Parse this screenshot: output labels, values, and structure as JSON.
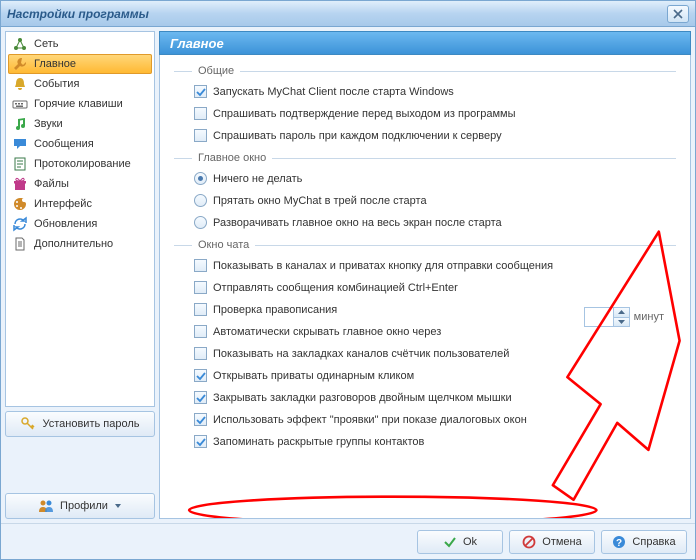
{
  "title": "Настройки программы",
  "section_title": "Главное",
  "sidebar": {
    "items": [
      {
        "key": "network",
        "label": "Сеть",
        "icon": "network-icon",
        "color": "#4a8a3a"
      },
      {
        "key": "main",
        "label": "Главное",
        "icon": "wrench-icon",
        "color": "#d08a2a",
        "selected": true
      },
      {
        "key": "events",
        "label": "События",
        "icon": "bell-icon",
        "color": "#d9a82a"
      },
      {
        "key": "hotkeys",
        "label": "Горячие клавиши",
        "icon": "keyboard-icon",
        "color": "#6a6a6a"
      },
      {
        "key": "sounds",
        "label": "Звуки",
        "icon": "music-icon",
        "color": "#3aa84a"
      },
      {
        "key": "messages",
        "label": "Сообщения",
        "icon": "chat-icon",
        "color": "#3a8ad8"
      },
      {
        "key": "logging",
        "label": "Протоколирование",
        "icon": "log-icon",
        "color": "#3a7a4a"
      },
      {
        "key": "files",
        "label": "Файлы",
        "icon": "gift-icon",
        "color": "#c03a8a"
      },
      {
        "key": "interface",
        "label": "Интерфейс",
        "icon": "palette-icon",
        "color": "#d08a2a"
      },
      {
        "key": "updates",
        "label": "Обновления",
        "icon": "refresh-icon",
        "color": "#3a8ad8"
      },
      {
        "key": "advanced",
        "label": "Дополнительно",
        "icon": "page-icon",
        "color": "#6a6a6a"
      }
    ],
    "set_password_label": "Установить пароль",
    "profiles_label": "Профили"
  },
  "groups": {
    "general": {
      "title": "Общие",
      "items": [
        {
          "key": "autostart",
          "label": "Запускать MyChat Client после старта Windows",
          "checked": true
        },
        {
          "key": "confirm_exit",
          "label": "Спрашивать подтверждение перед выходом из программы",
          "checked": false
        },
        {
          "key": "ask_password",
          "label": "Спрашивать пароль при каждом подключении к серверу",
          "checked": false
        }
      ]
    },
    "main_window": {
      "title": "Главное окно",
      "items": [
        {
          "key": "do_nothing",
          "label": "Ничего не делать",
          "checked": true
        },
        {
          "key": "hide_tray",
          "label": "Прятать окно MyChat в трей после старта",
          "checked": false
        },
        {
          "key": "maximize",
          "label": "Разворачивать главное окно на весь экран после старта",
          "checked": false
        }
      ]
    },
    "chat_window": {
      "title": "Окно чата",
      "items": [
        {
          "key": "show_send_btn",
          "label": "Показывать в каналах и приватах кнопку для отправки сообщения",
          "checked": false
        },
        {
          "key": "ctrl_enter",
          "label": "Отправлять сообщения комбинацией Ctrl+Enter",
          "checked": false
        },
        {
          "key": "spellcheck",
          "label": "Проверка правописания",
          "checked": false
        },
        {
          "key": "autohide",
          "label": "Автоматически скрывать главное окно через",
          "checked": false
        },
        {
          "key": "user_count",
          "label": "Показывать на закладках каналов счётчик пользователей",
          "checked": false
        },
        {
          "key": "single_click",
          "label": "Открывать приваты одинарным кликом",
          "checked": true
        },
        {
          "key": "dbl_close",
          "label": "Закрывать закладки разговоров двойным щелчком мышки",
          "checked": true
        },
        {
          "key": "fade_effect",
          "label": "Использовать эффект \"проявки\" при показе диалоговых окон",
          "checked": true
        },
        {
          "key": "remember_groups",
          "label": "Запоминать раскрытые группы контактов",
          "checked": true
        }
      ]
    }
  },
  "spinner": {
    "value": "",
    "unit": "минут"
  },
  "footer": {
    "ok": "Ok",
    "cancel": "Отмена",
    "help": "Справка"
  }
}
